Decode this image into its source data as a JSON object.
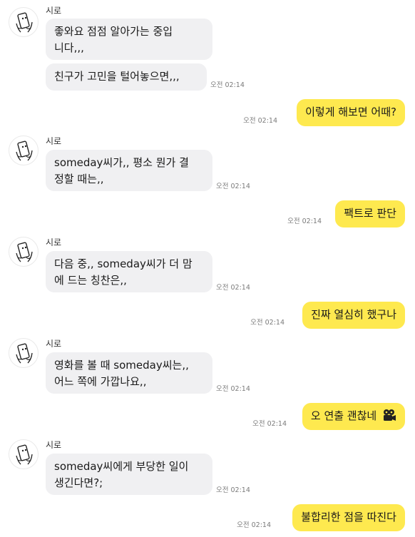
{
  "conversation": {
    "sender_name": "시로",
    "time_label": "오전 02:14",
    "blocks": [
      {
        "type": "in",
        "messages": [
          "좋와요 점점 알아가는 중입",
          "니다,,,"
        ],
        "second": "친구가 고민을 털어놓으면,,,"
      },
      {
        "type": "out",
        "text": "이렇게 해보면 어때?"
      },
      {
        "type": "in",
        "lines": [
          "someday씨가,, 평소 뭔가 결",
          "정할 때는,,"
        ]
      },
      {
        "type": "out",
        "text": "팩트로 판단"
      },
      {
        "type": "in",
        "lines": [
          "다음 중,, someday씨가 더 맘",
          "에 드는 칭찬은,,"
        ]
      },
      {
        "type": "out",
        "text": "진짜 열심히 했구나"
      },
      {
        "type": "in",
        "lines": [
          "영화를 볼 때 someday씨는,,",
          "어느 쪽에 가깝나요,,"
        ]
      },
      {
        "type": "out",
        "text": "오 연출 괜찮네",
        "icon": "film-projector-icon"
      },
      {
        "type": "in",
        "lines": [
          "someday씨에게 부당한 일이",
          "생긴다면?;"
        ]
      },
      {
        "type": "out",
        "text": "불합리한 점을 따진다"
      }
    ]
  },
  "colors": {
    "outgoing_bubble": "#fee94f",
    "incoming_bubble": "#f0f0f2",
    "timestamp": "#7b7b7b"
  }
}
